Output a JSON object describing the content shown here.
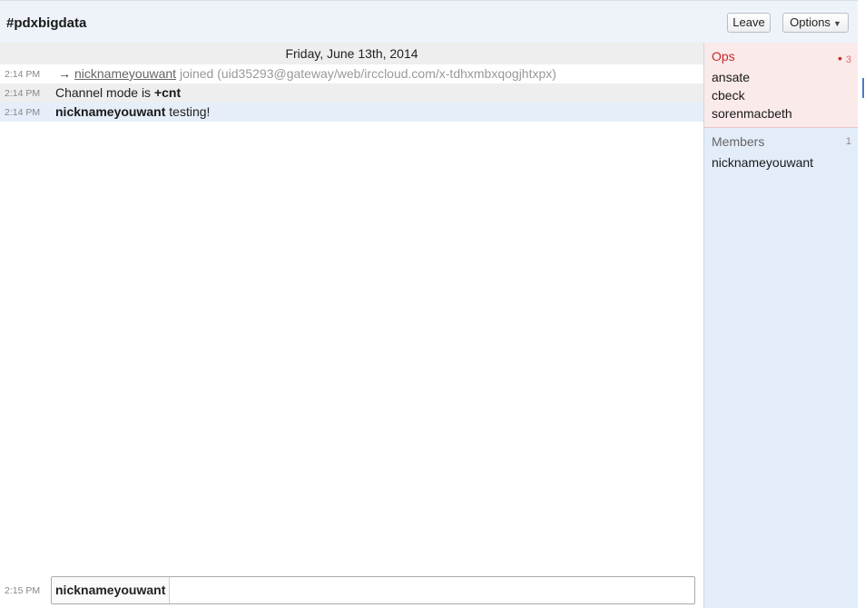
{
  "header": {
    "channel": "#pdxbigdata",
    "leave_label": "Leave",
    "options_label": "Options",
    "options_caret": "▼"
  },
  "log": {
    "date": "Friday, June 13th, 2014",
    "join": {
      "time": "2:14 PM",
      "arrow": "→",
      "nick": "nicknameyouwant",
      "rest": "joined (uid35293@gateway/web/irccloud.com/x-tdhxmbxqogjhtxpx)"
    },
    "mode": {
      "time": "2:14 PM",
      "text": "Channel mode is ",
      "value": "+cnt"
    },
    "message": {
      "time": "2:14 PM",
      "nick": "nicknameyouwant",
      "text": " testing!"
    }
  },
  "input": {
    "time": "2:15 PM",
    "nick": "nicknameyouwant",
    "value": ""
  },
  "sidebar": {
    "ops_heading": "Ops",
    "ops_count": "3",
    "ops": [
      "ansate",
      "cbeck",
      "sorenmacbeth"
    ],
    "members_heading": "Members",
    "members_count": "1",
    "members": [
      "nicknameyouwant"
    ]
  },
  "colors": {
    "ops_accent": "#c52a2a",
    "highlight_row": "#e6eef9",
    "sidebar_bg": "#e3edf9"
  }
}
